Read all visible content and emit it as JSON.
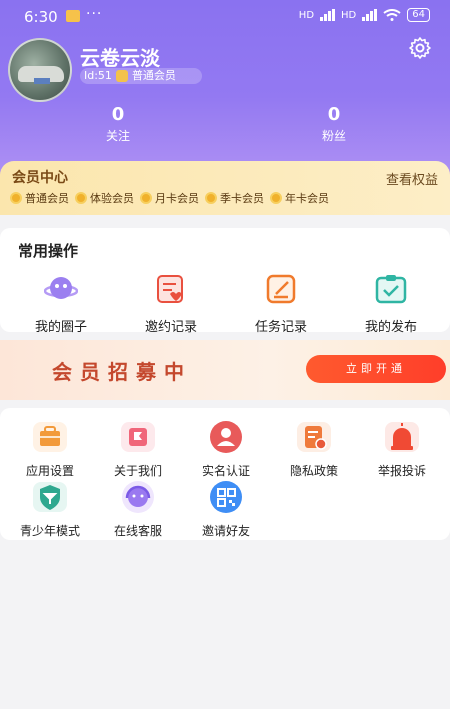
{
  "status": {
    "time": "6:30",
    "dots": "···",
    "battery": "64",
    "net1": "HD",
    "net2": "HD"
  },
  "profile": {
    "name": "云卷云淡",
    "id": "Id:51",
    "level": "普通会员"
  },
  "stats": [
    {
      "value": "0",
      "label": "关注"
    },
    {
      "value": "0",
      "label": "粉丝"
    }
  ],
  "member": {
    "title": "会员中心",
    "link": "查看权益",
    "tiers": [
      "普通会员",
      "体验会员",
      "月卡会员",
      "季卡会员",
      "年卡会员"
    ]
  },
  "common_ops": {
    "title": "常用操作",
    "items": [
      {
        "label": "我的圈子",
        "icon": "planet-icon"
      },
      {
        "label": "邀约记录",
        "icon": "invite-record-icon"
      },
      {
        "label": "任务记录",
        "icon": "task-record-icon"
      },
      {
        "label": "我的发布",
        "icon": "clipboard-check-icon"
      }
    ]
  },
  "banner": {
    "text": "会员招募中",
    "button": "立即开通"
  },
  "tools": [
    {
      "label": "应用设置",
      "icon": "briefcase-icon"
    },
    {
      "label": "关于我们",
      "icon": "flag-icon"
    },
    {
      "label": "实名认证",
      "icon": "id-verify-icon"
    },
    {
      "label": "隐私政策",
      "icon": "document-shield-icon"
    },
    {
      "label": "举报投诉",
      "icon": "siren-icon"
    },
    {
      "label": "青少年模式",
      "icon": "youth-shield-icon"
    },
    {
      "label": "在线客服",
      "icon": "headset-icon"
    },
    {
      "label": "邀请好友",
      "icon": "qrcode-icon"
    }
  ],
  "colors": {
    "header": "#8a72f0",
    "accent": "#ff4a2c",
    "member_bg": "#fbe6ad"
  }
}
